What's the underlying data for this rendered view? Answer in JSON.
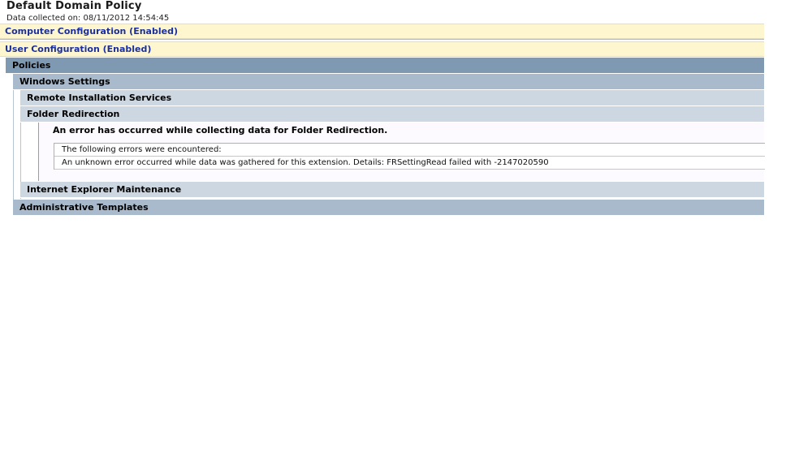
{
  "report": {
    "title": "Default Domain Policy",
    "collected": "Data collected on: 08/11/2012 14:54:45"
  },
  "computer_config": {
    "label": "Computer Configuration (Enabled)"
  },
  "user_config": {
    "label": "User Configuration (Enabled)"
  },
  "policies": {
    "label": "Policies"
  },
  "windows_settings": {
    "label": "Windows Settings"
  },
  "ris": {
    "label": "Remote Installation Services"
  },
  "folder_redirection": {
    "label": "Folder Redirection",
    "error_heading": "An error has occurred while collecting data for Folder Redirection.",
    "errors_intro": "The following errors were encountered:",
    "error_detail": "An unknown error occurred while data was gathered for this extension. Details: FRSettingRead failed with -2147020590"
  },
  "iem": {
    "label": "Internet Explorer Maintenance"
  },
  "admin_templates": {
    "label": "Administrative Templates"
  },
  "colors": {
    "config_bar_bg": "#fdf6cf",
    "config_text": "#1b2f9e",
    "level1_bg": "#7f99b3",
    "level2_bg": "#a8bacb",
    "level3_bg": "#cdd7e1"
  }
}
